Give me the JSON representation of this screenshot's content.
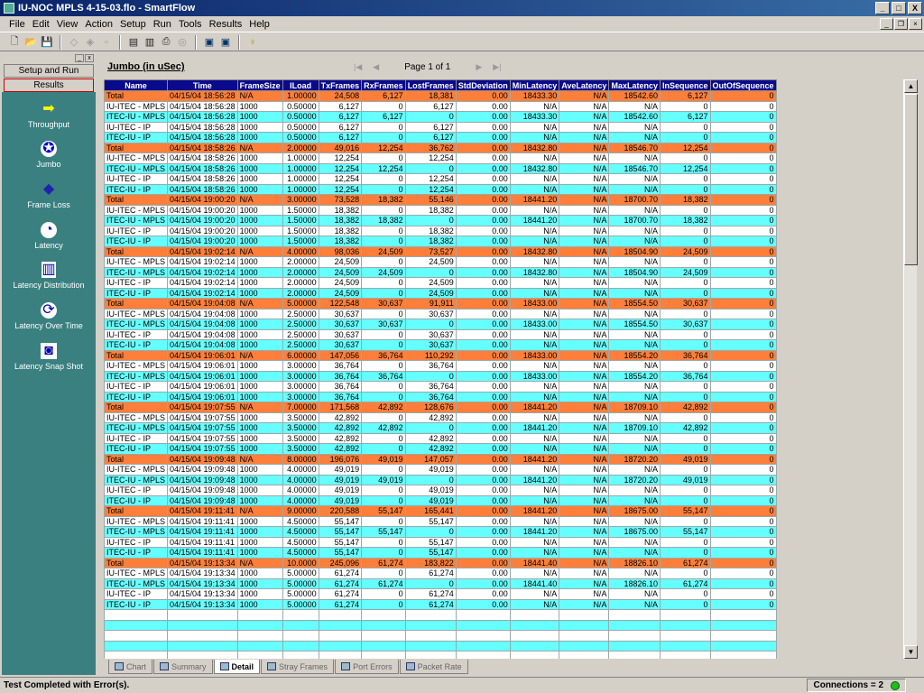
{
  "window": {
    "title": "IU-NOC MPLS 4-15-03.flo - SmartFlow",
    "min_label": "_",
    "max_label": "□",
    "close_label": "X"
  },
  "menu": [
    "File",
    "Edit",
    "View",
    "Action",
    "Setup",
    "Run",
    "Tools",
    "Results",
    "Help"
  ],
  "toolbar": {
    "icons": [
      "new-icon",
      "open-icon",
      "save-icon",
      "cut-icon",
      "copy-icon",
      "paste-icon",
      "preview-icon",
      "print-icon",
      "export-icon",
      "network-icon",
      "monitor-icon",
      "monitor2-icon",
      "help-icon"
    ]
  },
  "left_panel": {
    "tabs": [
      "Setup and Run",
      "Results"
    ],
    "active_tab": "Results",
    "items": [
      {
        "label": "Throughput",
        "icon": "arrow-right-icon"
      },
      {
        "label": "Jumbo",
        "icon": "jumbo-icon"
      },
      {
        "label": "Frame Loss",
        "icon": "frame-loss-icon"
      },
      {
        "label": "Latency",
        "icon": "latency-icon"
      },
      {
        "label": "Latency Distribution",
        "icon": "latency-distribution-icon"
      },
      {
        "label": "Latency Over Time",
        "icon": "latency-over-time-icon"
      },
      {
        "label": "Latency Snap Shot",
        "icon": "camera-icon"
      }
    ]
  },
  "report": {
    "title": "Jumbo (in uSec)",
    "page_label": "Page 1 of 1"
  },
  "grid": {
    "columns": [
      "Name",
      "Time",
      "FrameSize",
      "ILoad",
      "TxFrames",
      "RxFrames",
      "LostFrames",
      "StdDeviation",
      "MinLatency",
      "AveLatency",
      "MaxLatency",
      "InSequence",
      "OutOfSequence"
    ],
    "rows": [
      [
        "Total",
        "04/15/04 18:56:28",
        "N/A",
        "1.00000",
        "24,508",
        "6,127",
        "18,381",
        "0.00",
        "18433.30",
        "N/A",
        "18542.60",
        "6,127",
        "0"
      ],
      [
        "IU-ITEC - MPLS",
        "04/15/04 18:56:28",
        "1000",
        "0.50000",
        "6,127",
        "0",
        "6,127",
        "0.00",
        "N/A",
        "N/A",
        "N/A",
        "0",
        "0"
      ],
      [
        "ITEC-IU - MPLS",
        "04/15/04 18:56:28",
        "1000",
        "0.50000",
        "6,127",
        "6,127",
        "0",
        "0.00",
        "18433.30",
        "N/A",
        "18542.60",
        "6,127",
        "0"
      ],
      [
        "IU-ITEC - IP",
        "04/15/04 18:56:28",
        "1000",
        "0.50000",
        "6,127",
        "0",
        "6,127",
        "0.00",
        "N/A",
        "N/A",
        "N/A",
        "0",
        "0"
      ],
      [
        "ITEC-IU - IP",
        "04/15/04 18:56:28",
        "1000",
        "0.50000",
        "6,127",
        "0",
        "6,127",
        "0.00",
        "N/A",
        "N/A",
        "N/A",
        "0",
        "0"
      ],
      [
        "Total",
        "04/15/04 18:58:26",
        "N/A",
        "2.00000",
        "49,016",
        "12,254",
        "36,762",
        "0.00",
        "18432.80",
        "N/A",
        "18546.70",
        "12,254",
        "0"
      ],
      [
        "IU-ITEC - MPLS",
        "04/15/04 18:58:26",
        "1000",
        "1.00000",
        "12,254",
        "0",
        "12,254",
        "0.00",
        "N/A",
        "N/A",
        "N/A",
        "0",
        "0"
      ],
      [
        "ITEC-IU - MPLS",
        "04/15/04 18:58:26",
        "1000",
        "1.00000",
        "12,254",
        "12,254",
        "0",
        "0.00",
        "18432.80",
        "N/A",
        "18546.70",
        "12,254",
        "0"
      ],
      [
        "IU-ITEC - IP",
        "04/15/04 18:58:26",
        "1000",
        "1.00000",
        "12,254",
        "0",
        "12,254",
        "0.00",
        "N/A",
        "N/A",
        "N/A",
        "0",
        "0"
      ],
      [
        "ITEC-IU - IP",
        "04/15/04 18:58:26",
        "1000",
        "1.00000",
        "12,254",
        "0",
        "12,254",
        "0.00",
        "N/A",
        "N/A",
        "N/A",
        "0",
        "0"
      ],
      [
        "Total",
        "04/15/04 19:00:20",
        "N/A",
        "3.00000",
        "73,528",
        "18,382",
        "55,146",
        "0.00",
        "18441.20",
        "N/A",
        "18700.70",
        "18,382",
        "0"
      ],
      [
        "IU-ITEC - MPLS",
        "04/15/04 19:00:20",
        "1000",
        "1.50000",
        "18,382",
        "0",
        "18,382",
        "0.00",
        "N/A",
        "N/A",
        "N/A",
        "0",
        "0"
      ],
      [
        "ITEC-IU - MPLS",
        "04/15/04 19:00:20",
        "1000",
        "1.50000",
        "18,382",
        "18,382",
        "0",
        "0.00",
        "18441.20",
        "N/A",
        "18700.70",
        "18,382",
        "0"
      ],
      [
        "IU-ITEC - IP",
        "04/15/04 19:00:20",
        "1000",
        "1.50000",
        "18,382",
        "0",
        "18,382",
        "0.00",
        "N/A",
        "N/A",
        "N/A",
        "0",
        "0"
      ],
      [
        "ITEC-IU - IP",
        "04/15/04 19:00:20",
        "1000",
        "1.50000",
        "18,382",
        "0",
        "18,382",
        "0.00",
        "N/A",
        "N/A",
        "N/A",
        "0",
        "0"
      ],
      [
        "Total",
        "04/15/04 19:02:14",
        "N/A",
        "4.00000",
        "98,036",
        "24,509",
        "73,527",
        "0.00",
        "18432.80",
        "N/A",
        "18504.90",
        "24,509",
        "0"
      ],
      [
        "IU-ITEC - MPLS",
        "04/15/04 19:02:14",
        "1000",
        "2.00000",
        "24,509",
        "0",
        "24,509",
        "0.00",
        "N/A",
        "N/A",
        "N/A",
        "0",
        "0"
      ],
      [
        "ITEC-IU - MPLS",
        "04/15/04 19:02:14",
        "1000",
        "2.00000",
        "24,509",
        "24,509",
        "0",
        "0.00",
        "18432.80",
        "N/A",
        "18504.90",
        "24,509",
        "0"
      ],
      [
        "IU-ITEC - IP",
        "04/15/04 19:02:14",
        "1000",
        "2.00000",
        "24,509",
        "0",
        "24,509",
        "0.00",
        "N/A",
        "N/A",
        "N/A",
        "0",
        "0"
      ],
      [
        "ITEC-IU - IP",
        "04/15/04 19:02:14",
        "1000",
        "2.00000",
        "24,509",
        "0",
        "24,509",
        "0.00",
        "N/A",
        "N/A",
        "N/A",
        "0",
        "0"
      ],
      [
        "Total",
        "04/15/04 19:04:08",
        "N/A",
        "5.00000",
        "122,548",
        "30,637",
        "91,911",
        "0.00",
        "18433.00",
        "N/A",
        "18554.50",
        "30,637",
        "0"
      ],
      [
        "IU-ITEC - MPLS",
        "04/15/04 19:04:08",
        "1000",
        "2.50000",
        "30,637",
        "0",
        "30,637",
        "0.00",
        "N/A",
        "N/A",
        "N/A",
        "0",
        "0"
      ],
      [
        "ITEC-IU - MPLS",
        "04/15/04 19:04:08",
        "1000",
        "2.50000",
        "30,637",
        "30,637",
        "0",
        "0.00",
        "18433.00",
        "N/A",
        "18554.50",
        "30,637",
        "0"
      ],
      [
        "IU-ITEC - IP",
        "04/15/04 19:04:08",
        "1000",
        "2.50000",
        "30,637",
        "0",
        "30,637",
        "0.00",
        "N/A",
        "N/A",
        "N/A",
        "0",
        "0"
      ],
      [
        "ITEC-IU - IP",
        "04/15/04 19:04:08",
        "1000",
        "2.50000",
        "30,637",
        "0",
        "30,637",
        "0.00",
        "N/A",
        "N/A",
        "N/A",
        "0",
        "0"
      ],
      [
        "Total",
        "04/15/04 19:06:01",
        "N/A",
        "6.00000",
        "147,056",
        "36,764",
        "110,292",
        "0.00",
        "18433.00",
        "N/A",
        "18554.20",
        "36,764",
        "0"
      ],
      [
        "IU-ITEC - MPLS",
        "04/15/04 19:06:01",
        "1000",
        "3.00000",
        "36,764",
        "0",
        "36,764",
        "0.00",
        "N/A",
        "N/A",
        "N/A",
        "0",
        "0"
      ],
      [
        "ITEC-IU - MPLS",
        "04/15/04 19:06:01",
        "1000",
        "3.00000",
        "36,764",
        "36,764",
        "0",
        "0.00",
        "18433.00",
        "N/A",
        "18554.20",
        "36,764",
        "0"
      ],
      [
        "IU-ITEC - IP",
        "04/15/04 19:06:01",
        "1000",
        "3.00000",
        "36,764",
        "0",
        "36,764",
        "0.00",
        "N/A",
        "N/A",
        "N/A",
        "0",
        "0"
      ],
      [
        "ITEC-IU - IP",
        "04/15/04 19:06:01",
        "1000",
        "3.00000",
        "36,764",
        "0",
        "36,764",
        "0.00",
        "N/A",
        "N/A",
        "N/A",
        "0",
        "0"
      ],
      [
        "Total",
        "04/15/04 19:07:55",
        "N/A",
        "7.00000",
        "171,568",
        "42,892",
        "128,676",
        "0.00",
        "18441.20",
        "N/A",
        "18709.10",
        "42,892",
        "0"
      ],
      [
        "IU-ITEC - MPLS",
        "04/15/04 19:07:55",
        "1000",
        "3.50000",
        "42,892",
        "0",
        "42,892",
        "0.00",
        "N/A",
        "N/A",
        "N/A",
        "0",
        "0"
      ],
      [
        "ITEC-IU - MPLS",
        "04/15/04 19:07:55",
        "1000",
        "3.50000",
        "42,892",
        "42,892",
        "0",
        "0.00",
        "18441.20",
        "N/A",
        "18709.10",
        "42,892",
        "0"
      ],
      [
        "IU-ITEC - IP",
        "04/15/04 19:07:55",
        "1000",
        "3.50000",
        "42,892",
        "0",
        "42,892",
        "0.00",
        "N/A",
        "N/A",
        "N/A",
        "0",
        "0"
      ],
      [
        "ITEC-IU - IP",
        "04/15/04 19:07:55",
        "1000",
        "3.50000",
        "42,892",
        "0",
        "42,892",
        "0.00",
        "N/A",
        "N/A",
        "N/A",
        "0",
        "0"
      ],
      [
        "Total",
        "04/15/04 19:09:48",
        "N/A",
        "8.00000",
        "196,076",
        "49,019",
        "147,057",
        "0.00",
        "18441.20",
        "N/A",
        "18720.20",
        "49,019",
        "0"
      ],
      [
        "IU-ITEC - MPLS",
        "04/15/04 19:09:48",
        "1000",
        "4.00000",
        "49,019",
        "0",
        "49,019",
        "0.00",
        "N/A",
        "N/A",
        "N/A",
        "0",
        "0"
      ],
      [
        "ITEC-IU - MPLS",
        "04/15/04 19:09:48",
        "1000",
        "4.00000",
        "49,019",
        "49,019",
        "0",
        "0.00",
        "18441.20",
        "N/A",
        "18720.20",
        "49,019",
        "0"
      ],
      [
        "IU-ITEC - IP",
        "04/15/04 19:09:48",
        "1000",
        "4.00000",
        "49,019",
        "0",
        "49,019",
        "0.00",
        "N/A",
        "N/A",
        "N/A",
        "0",
        "0"
      ],
      [
        "ITEC-IU - IP",
        "04/15/04 19:09:48",
        "1000",
        "4.00000",
        "49,019",
        "0",
        "49,019",
        "0.00",
        "N/A",
        "N/A",
        "N/A",
        "0",
        "0"
      ],
      [
        "Total",
        "04/15/04 19:11:41",
        "N/A",
        "9.00000",
        "220,588",
        "55,147",
        "165,441",
        "0.00",
        "18441.20",
        "N/A",
        "18675.00",
        "55,147",
        "0"
      ],
      [
        "IU-ITEC - MPLS",
        "04/15/04 19:11:41",
        "1000",
        "4.50000",
        "55,147",
        "0",
        "55,147",
        "0.00",
        "N/A",
        "N/A",
        "N/A",
        "0",
        "0"
      ],
      [
        "ITEC-IU - MPLS",
        "04/15/04 19:11:41",
        "1000",
        "4.50000",
        "55,147",
        "55,147",
        "0",
        "0.00",
        "18441.20",
        "N/A",
        "18675.00",
        "55,147",
        "0"
      ],
      [
        "IU-ITEC - IP",
        "04/15/04 19:11:41",
        "1000",
        "4.50000",
        "55,147",
        "0",
        "55,147",
        "0.00",
        "N/A",
        "N/A",
        "N/A",
        "0",
        "0"
      ],
      [
        "ITEC-IU - IP",
        "04/15/04 19:11:41",
        "1000",
        "4.50000",
        "55,147",
        "0",
        "55,147",
        "0.00",
        "N/A",
        "N/A",
        "N/A",
        "0",
        "0"
      ],
      [
        "Total",
        "04/15/04 19:13:34",
        "N/A",
        "10.0000",
        "245,096",
        "61,274",
        "183,822",
        "0.00",
        "18441.40",
        "N/A",
        "18826.10",
        "61,274",
        "0"
      ],
      [
        "IU-ITEC - MPLS",
        "04/15/04 19:13:34",
        "1000",
        "5.00000",
        "61,274",
        "0",
        "61,274",
        "0.00",
        "N/A",
        "N/A",
        "N/A",
        "0",
        "0"
      ],
      [
        "ITEC-IU - MPLS",
        "04/15/04 19:13:34",
        "1000",
        "5.00000",
        "61,274",
        "61,274",
        "0",
        "0.00",
        "18441.40",
        "N/A",
        "18826.10",
        "61,274",
        "0"
      ],
      [
        "IU-ITEC - IP",
        "04/15/04 19:13:34",
        "1000",
        "5.00000",
        "61,274",
        "0",
        "61,274",
        "0.00",
        "N/A",
        "N/A",
        "N/A",
        "0",
        "0"
      ],
      [
        "ITEC-IU - IP",
        "04/15/04 19:13:34",
        "1000",
        "5.00000",
        "61,274",
        "0",
        "61,274",
        "0.00",
        "N/A",
        "N/A",
        "N/A",
        "0",
        "0"
      ]
    ]
  },
  "bottom_tabs": [
    {
      "label": "Chart",
      "active": false
    },
    {
      "label": "Summary",
      "active": false
    },
    {
      "label": "Detail",
      "active": true
    },
    {
      "label": "Stray Frames",
      "active": false
    },
    {
      "label": "Port Errors",
      "active": false
    },
    {
      "label": "Packet Rate",
      "active": false
    }
  ],
  "status": {
    "message": "Test Completed with Error(s).",
    "connections": "Connections = 2"
  },
  "colors": {
    "total_row": "#ff7f3a",
    "cyan_row": "#66ffff",
    "header": "#0a0a8c",
    "nav_bg": "#3a8080"
  }
}
